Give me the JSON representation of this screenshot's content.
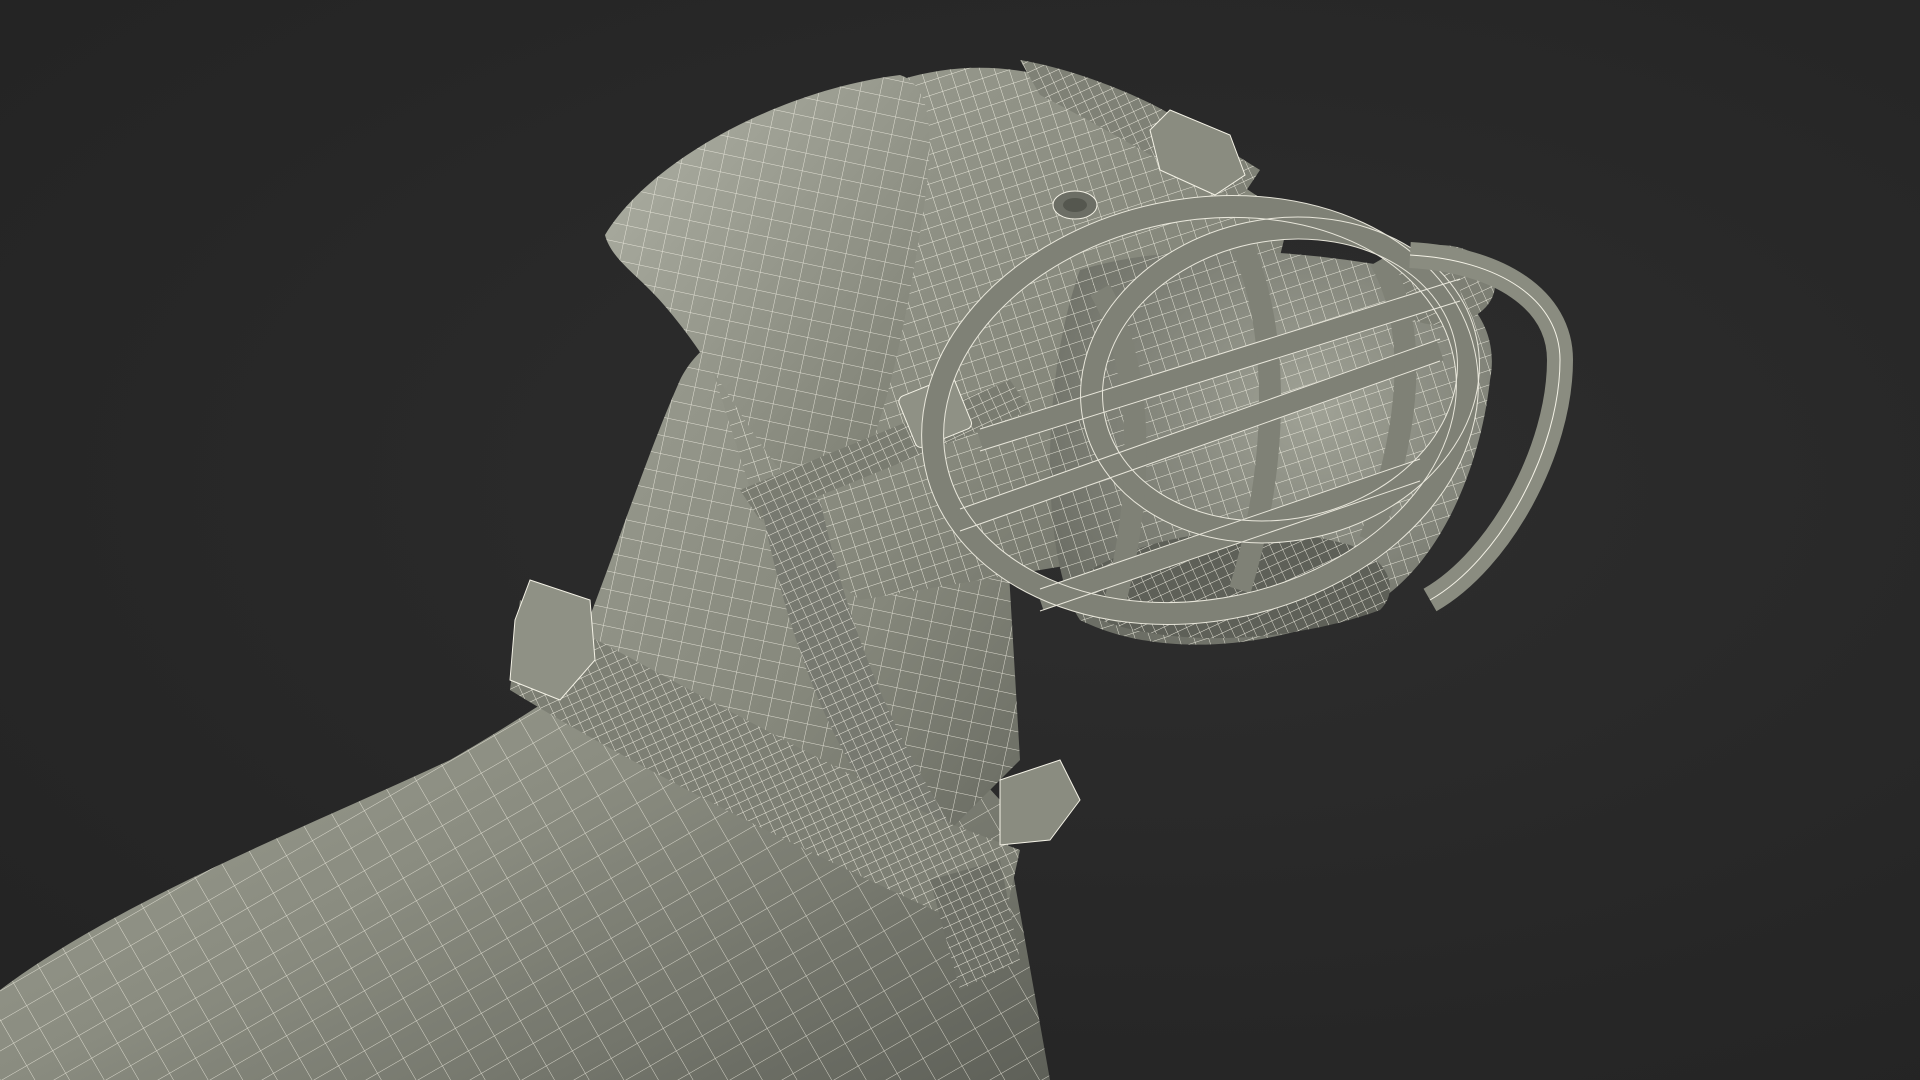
{
  "scene": {
    "subject": "dog-head-with-muzzle-wireframe",
    "colors": {
      "background": "#2a2a2a",
      "surface": "#8a8c80",
      "surface_light": "#b4b6aa",
      "surface_dark": "#5e6058",
      "wire": "#f4f2e6",
      "shadow": "#3a3b36"
    }
  }
}
